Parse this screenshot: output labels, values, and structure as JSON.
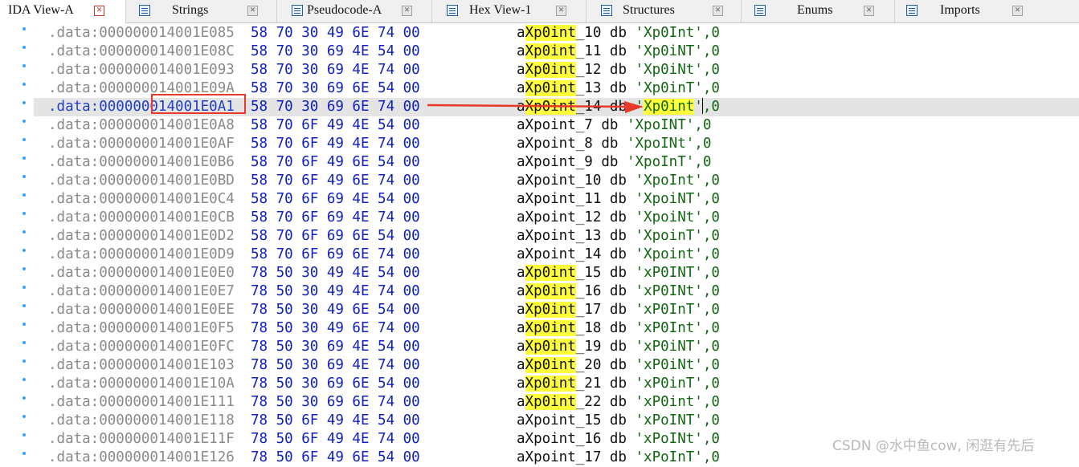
{
  "tabs": [
    {
      "label": "IDA View-A",
      "icon": "none",
      "active": true
    },
    {
      "label": "Strings",
      "icon": "strings-icon"
    },
    {
      "label": "Pseudocode-A",
      "icon": "pseudocode-icon"
    },
    {
      "label": "Hex View-1",
      "icon": "hex-view-icon"
    },
    {
      "label": "Structures",
      "icon": "structures-icon"
    },
    {
      "label": "Enums",
      "icon": "enums-icon"
    },
    {
      "label": "Imports",
      "icon": "imports-icon"
    }
  ],
  "tab_close_glyph": "✕",
  "highlight_text": "Xp0int",
  "highlight_color": "#ffff3c",
  "selected_row": 4,
  "rows": [
    {
      "addr": ".data:000000014001E085",
      "bytes": "58 70 30 49 6E 74 00",
      "name": "aXp0int_10",
      "db": "db",
      "str": "'Xp0Int'",
      "tail": ",0"
    },
    {
      "addr": ".data:000000014001E08C",
      "bytes": "58 70 30 69 4E 54 00",
      "name": "aXp0int_11",
      "db": "db",
      "str": "'Xp0iNT'",
      "tail": ",0"
    },
    {
      "addr": ".data:000000014001E093",
      "bytes": "58 70 30 69 4E 74 00",
      "name": "aXp0int_12",
      "db": "db",
      "str": "'Xp0iNt'",
      "tail": ",0"
    },
    {
      "addr": ".data:000000014001E09A",
      "bytes": "58 70 30 69 6E 54 00",
      "name": "aXp0int_13",
      "db": "db",
      "str": "'Xp0inT'",
      "tail": ",0"
    },
    {
      "addr": ".data:000000014001E0A1",
      "bytes": "58 70 30 69 6E 74 00",
      "name": "aXp0int_14",
      "db": "db",
      "str": "'Xp0int'",
      "tail": ",0"
    },
    {
      "addr": ".data:000000014001E0A8",
      "bytes": "58 70 6F 49 4E 54 00",
      "name": "aXpoint_7",
      "db": "db",
      "str": "'XpoINT'",
      "tail": ",0"
    },
    {
      "addr": ".data:000000014001E0AF",
      "bytes": "58 70 6F 49 4E 74 00",
      "name": "aXpoint_8",
      "db": "db",
      "str": "'XpoINt'",
      "tail": ",0"
    },
    {
      "addr": ".data:000000014001E0B6",
      "bytes": "58 70 6F 49 6E 54 00",
      "name": "aXpoint_9",
      "db": "db",
      "str": "'XpoInT'",
      "tail": ",0"
    },
    {
      "addr": ".data:000000014001E0BD",
      "bytes": "58 70 6F 49 6E 74 00",
      "name": "aXpoint_10",
      "db": "db",
      "str": "'XpoInt'",
      "tail": ",0"
    },
    {
      "addr": ".data:000000014001E0C4",
      "bytes": "58 70 6F 69 4E 54 00",
      "name": "aXpoint_11",
      "db": "db",
      "str": "'XpoiNT'",
      "tail": ",0"
    },
    {
      "addr": ".data:000000014001E0CB",
      "bytes": "58 70 6F 69 4E 74 00",
      "name": "aXpoint_12",
      "db": "db",
      "str": "'XpoiNt'",
      "tail": ",0"
    },
    {
      "addr": ".data:000000014001E0D2",
      "bytes": "58 70 6F 69 6E 54 00",
      "name": "aXpoint_13",
      "db": "db",
      "str": "'XpoinT'",
      "tail": ",0"
    },
    {
      "addr": ".data:000000014001E0D9",
      "bytes": "58 70 6F 69 6E 74 00",
      "name": "aXpoint_14",
      "db": "db",
      "str": "'Xpoint'",
      "tail": ",0"
    },
    {
      "addr": ".data:000000014001E0E0",
      "bytes": "78 50 30 49 4E 54 00",
      "name": "aXp0int_15",
      "db": "db",
      "str": "'xP0INT'",
      "tail": ",0"
    },
    {
      "addr": ".data:000000014001E0E7",
      "bytes": "78 50 30 49 4E 74 00",
      "name": "aXp0int_16",
      "db": "db",
      "str": "'xP0INt'",
      "tail": ",0"
    },
    {
      "addr": ".data:000000014001E0EE",
      "bytes": "78 50 30 49 6E 54 00",
      "name": "aXp0int_17",
      "db": "db",
      "str": "'xP0InT'",
      "tail": ",0"
    },
    {
      "addr": ".data:000000014001E0F5",
      "bytes": "78 50 30 49 6E 74 00",
      "name": "aXp0int_18",
      "db": "db",
      "str": "'xP0Int'",
      "tail": ",0"
    },
    {
      "addr": ".data:000000014001E0FC",
      "bytes": "78 50 30 69 4E 54 00",
      "name": "aXp0int_19",
      "db": "db",
      "str": "'xP0iNT'",
      "tail": ",0"
    },
    {
      "addr": ".data:000000014001E103",
      "bytes": "78 50 30 69 4E 74 00",
      "name": "aXp0int_20",
      "db": "db",
      "str": "'xP0iNt'",
      "tail": ",0"
    },
    {
      "addr": ".data:000000014001E10A",
      "bytes": "78 50 30 69 6E 54 00",
      "name": "aXp0int_21",
      "db": "db",
      "str": "'xP0inT'",
      "tail": ",0"
    },
    {
      "addr": ".data:000000014001E111",
      "bytes": "78 50 30 69 6E 74 00",
      "name": "aXp0int_22",
      "db": "db",
      "str": "'xP0int'",
      "tail": ",0"
    },
    {
      "addr": ".data:000000014001E118",
      "bytes": "78 50 6F 49 4E 54 00",
      "name": "aXpoint_15",
      "db": "db",
      "str": "'xPoINT'",
      "tail": ",0"
    },
    {
      "addr": ".data:000000014001E11F",
      "bytes": "78 50 6F 49 4E 74 00",
      "name": "aXpoint_16",
      "db": "db",
      "str": "'xPoINt'",
      "tail": ",0"
    },
    {
      "addr": ".data:000000014001E126",
      "bytes": "78 50 6F 49 6E 54 00",
      "name": "aXpoint_17",
      "db": "db",
      "str": "'xPoInT'",
      "tail": ",0"
    }
  ],
  "annotation": {
    "box_color": "#e8392a",
    "arrow_color": "#e8392a"
  },
  "watermark": "CSDN @水中鱼cow, 闲逛有先后"
}
